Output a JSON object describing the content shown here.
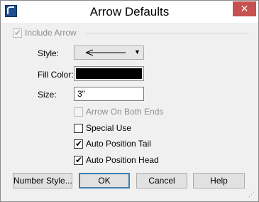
{
  "window": {
    "title": "Arrow Defaults"
  },
  "titlebar": {
    "close_glyph": "✕"
  },
  "include_arrow": {
    "label": "Include Arrow",
    "checked": true,
    "enabled": false
  },
  "style": {
    "label": "Style:",
    "selected_icon": "left-arrow-line-icon",
    "dropdown_glyph": "▼"
  },
  "fill_color": {
    "label": "Fill Color:",
    "value": "#000000"
  },
  "size": {
    "label": "Size:",
    "value": "3\""
  },
  "arrow_both_ends": {
    "label": "Arrow On Both Ends",
    "checked": false,
    "enabled": false
  },
  "special_use": {
    "label": "Special Use",
    "checked": false
  },
  "auto_position_tail": {
    "label": "Auto Position Tail",
    "checked": true
  },
  "auto_position_head": {
    "label": "Auto Position Head",
    "checked": true
  },
  "buttons": {
    "number_style": "Number Style...",
    "ok": "OK",
    "cancel": "Cancel",
    "help": "Help"
  },
  "checkmark_glyph": "✔",
  "resize_glyph": "⋰"
}
